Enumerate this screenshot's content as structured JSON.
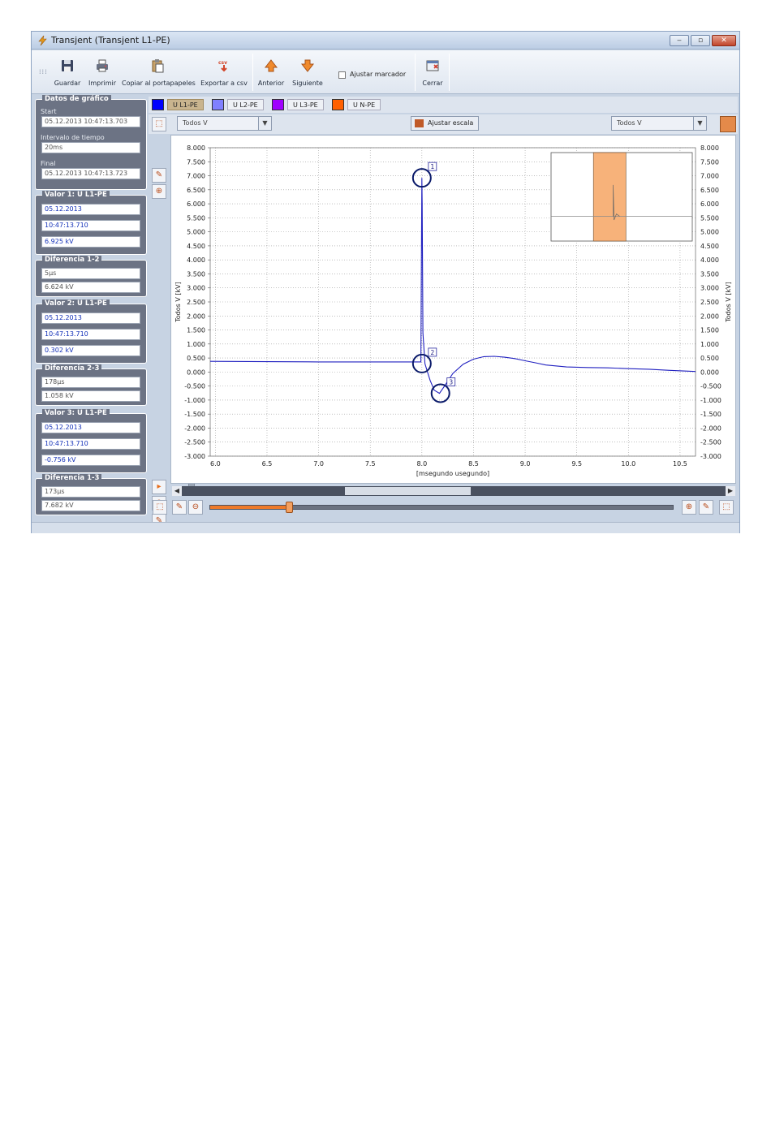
{
  "window": {
    "title": "Transjent (Transjent L1-PE)"
  },
  "toolbar": {
    "buttons": [
      {
        "label": "Guardar",
        "icon": "floppy-save-icon"
      },
      {
        "label": "Imprimir",
        "icon": "printer-icon"
      },
      {
        "label": "Copiar al portapapeles",
        "icon": "clipboard-copy-icon"
      },
      {
        "label": "Exportar a csv",
        "icon": "csv-export-icon"
      },
      {
        "label": "Anterior",
        "icon": "arrow-up-icon"
      },
      {
        "label": "Siguiente",
        "icon": "arrow-down-icon"
      },
      {
        "label": "Cerrar",
        "icon": "close-window-icon"
      }
    ],
    "checkbox_label": "Ajustar marcador"
  },
  "panel": {
    "datos": {
      "title": "Datos de gráfico",
      "start_label": "Start",
      "start": "05.12.2013 10:47:13.703",
      "intervalo_label": "Intervalo de tiempo",
      "intervalo": "20ms",
      "final_label": "Final",
      "final": "05.12.2013 10:47:13.723"
    },
    "valor1": {
      "title": "Valor 1: U L1-PE",
      "date": "05.12.2013",
      "time": "10:47:13.710",
      "value": "6.925 kV"
    },
    "diff12": {
      "title": "Diferencia 1-2",
      "time": "5µs",
      "value": "6.624 kV"
    },
    "valor2": {
      "title": "Valor 2: U L1-PE",
      "date": "05.12.2013",
      "time": "10:47:13.710",
      "value": "0.302 kV"
    },
    "diff23": {
      "title": "Diferencia 2-3",
      "time": "178µs",
      "value": "1.058 kV"
    },
    "valor3": {
      "title": "Valor 3: U L1-PE",
      "date": "05.12.2013",
      "time": "10:47:13.710",
      "value": "-0.756 kV"
    },
    "diff13": {
      "title": "Diferencia 1-3",
      "time": "173µs",
      "value": "7.682 kV"
    }
  },
  "legend": [
    {
      "label": "U L1-PE",
      "color": "#0000ff",
      "selected": true
    },
    {
      "label": "U L2-PE",
      "color": "#8080ff",
      "selected": false
    },
    {
      "label": "U L3-PE",
      "color": "#a000ff",
      "selected": false
    },
    {
      "label": "U N-PE",
      "color": "#ff6000",
      "selected": false
    }
  ],
  "controls": {
    "left_combo": "Todos V",
    "right_combo": "Todos V",
    "scale_button": "Ajustar escala"
  },
  "chart_data": {
    "type": "line",
    "xlabel": "[msegundo usegundo]",
    "ylabel": "Todos V [kV]",
    "ylabel_right": "Todos V [kV]",
    "xlim": [
      5.95,
      10.65
    ],
    "ylim": [
      -3.0,
      8.0
    ],
    "xticks": [
      6.0,
      6.5,
      7.0,
      7.5,
      8.0,
      8.5,
      9.0,
      9.5,
      10.0,
      10.5
    ],
    "yticks": [
      8.0,
      7.5,
      7.0,
      6.5,
      6.0,
      5.5,
      5.0,
      4.5,
      4.0,
      3.5,
      3.0,
      2.5,
      2.0,
      1.5,
      1.0,
      0.5,
      0.0,
      -0.5,
      -1.0,
      -1.5,
      -2.0,
      -2.5,
      -3.0
    ],
    "grid": true,
    "series": [
      {
        "name": "U L1-PE",
        "color": "#2020c0",
        "x": [
          5.95,
          6.5,
          7.0,
          7.5,
          7.99,
          8.0,
          8.003,
          8.01,
          8.03,
          8.05,
          8.08,
          8.12,
          8.17,
          8.22,
          8.3,
          8.4,
          8.5,
          8.6,
          8.7,
          8.8,
          8.9,
          9.0,
          9.1,
          9.2,
          9.4,
          9.6,
          9.8,
          10.0,
          10.2,
          10.4,
          10.65
        ],
        "y": [
          0.38,
          0.37,
          0.36,
          0.36,
          0.36,
          6.92,
          6.0,
          1.4,
          0.3,
          0.05,
          -0.3,
          -0.65,
          -0.76,
          -0.5,
          -0.05,
          0.28,
          0.46,
          0.55,
          0.56,
          0.53,
          0.48,
          0.4,
          0.33,
          0.25,
          0.18,
          0.16,
          0.15,
          0.12,
          0.1,
          0.06,
          0.02
        ]
      }
    ],
    "markers": [
      {
        "label": "1",
        "x": 8.0,
        "y": 6.925
      },
      {
        "label": "2",
        "x": 8.0,
        "y": 0.302
      },
      {
        "label": "3",
        "x": 8.18,
        "y": -0.756
      }
    ],
    "overview_selection": [
      0.3,
      0.53
    ]
  },
  "zoom": {
    "position": 0.17
  }
}
